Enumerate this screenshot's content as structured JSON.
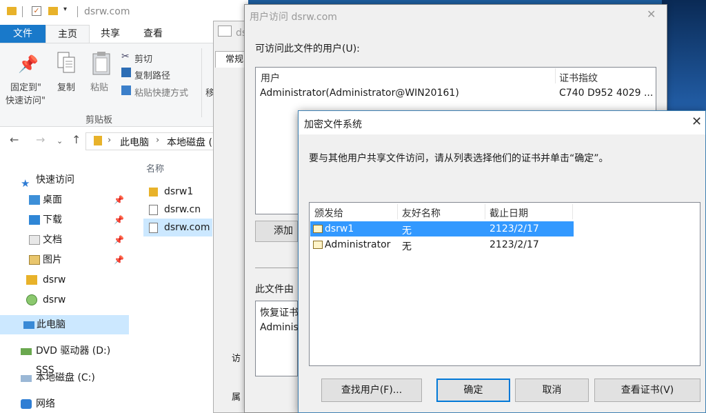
{
  "explorer": {
    "window_title": "dsrw.com",
    "tabs": {
      "file": "文件",
      "home": "主页",
      "share": "共享",
      "view": "查看"
    },
    "ribbon": {
      "pin_label": "固定到\"\n快速访问\"",
      "pin_line1": "固定到\"",
      "pin_line2": "快速访问\"",
      "copy": "复制",
      "paste": "粘贴",
      "cut": "剪切",
      "copy_path": "复制路径",
      "paste_shortcut": "粘贴快捷方式",
      "move_partial": "移",
      "group_clipboard": "剪贴板"
    },
    "address": {
      "segment1": "此电脑",
      "segment2": "本地磁盘 ("
    },
    "sidebar": [
      {
        "label": "快速访问",
        "icon": "star-icon"
      },
      {
        "label": "桌面",
        "icon": "desktop-folder-icon"
      },
      {
        "label": "下载",
        "icon": "downloads-folder-icon"
      },
      {
        "label": "文档",
        "icon": "documents-folder-icon"
      },
      {
        "label": "图片",
        "icon": "pictures-folder-icon"
      },
      {
        "label": "dsrw",
        "icon": "folder-icon"
      },
      {
        "label": "dsrw",
        "icon": "network-folder-icon"
      },
      {
        "label": "此电脑",
        "icon": "computer-icon"
      },
      {
        "label": "DVD 驱动器 (D:) SSS",
        "icon": "dvd-drive-icon"
      },
      {
        "label": "本地磁盘 (C:)",
        "icon": "disk-icon"
      },
      {
        "label": "网络",
        "icon": "network-icon"
      }
    ],
    "column_name": "名称",
    "files": [
      {
        "name": "dsrw1",
        "type": "folder"
      },
      {
        "name": "dsrw.cn",
        "type": "file"
      },
      {
        "name": "dsrw.com",
        "type": "file"
      }
    ]
  },
  "props": {
    "tab_partial": "常规",
    "label_partial": "访",
    "label_partial2": "属"
  },
  "user_access": {
    "title": "用户访问 dsrw.com",
    "label": "可访问此文件的用户(U):",
    "col_user": "用户",
    "col_thumbprint": "证书指纹",
    "row_user": "Administrator(Administrator@WIN20161)",
    "row_thumbprint": "C740 D952 4029 ...",
    "add_button_partial": "添加",
    "recovery_label_partial": "此文件由",
    "recovery_col_partial": "恢复证书",
    "recovery_row_partial": "Adminis"
  },
  "efs": {
    "title": "加密文件系统",
    "message": "要与其他用户共享文件访问，请从列表选择他们的证书并单击“确定”。",
    "columns": {
      "issued_to": "颁发给",
      "friendly_name": "友好名称",
      "expiry": "截止日期"
    },
    "rows": [
      {
        "issued_to": "dsrw1",
        "friendly_name": "无",
        "expiry": "2123/2/17",
        "selected": true
      },
      {
        "issued_to": "Administrator",
        "friendly_name": "无",
        "expiry": "2123/2/17",
        "selected": false
      }
    ],
    "buttons": {
      "find_user": "查找用户(F)...",
      "ok": "确定",
      "cancel": "取消",
      "view_cert": "查看证书(V)"
    }
  },
  "colors": {
    "accent": "#1979ca",
    "selection": "#3399ff",
    "light_selection": "#cce8ff"
  }
}
